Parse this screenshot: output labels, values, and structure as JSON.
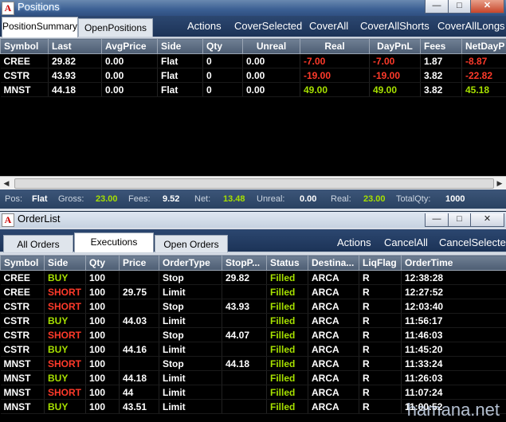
{
  "positions_window": {
    "title": "Positions",
    "app_icon": "A",
    "controls": [
      "minimize-icon",
      "maximize-icon",
      "close-icon"
    ],
    "tabs": [
      {
        "label": "PositionSummary",
        "active": true
      },
      {
        "label": "OpenPositions",
        "active": false
      }
    ],
    "toolbar": [
      "Actions",
      "CoverSelected",
      "CoverAll",
      "CoverAllShorts",
      "CoverAllLongs"
    ],
    "columns": [
      "Symbol",
      "Last",
      "AvgPrice",
      "Side",
      "Qty",
      "Unreal",
      "Real",
      "DayPnL",
      "Fees",
      "NetDayP"
    ],
    "rows": [
      [
        "CREE",
        "29.82",
        "0.00",
        "Flat",
        "0",
        "0.00",
        "-7.00",
        "-7.00",
        "1.87",
        "-8.87"
      ],
      [
        "CSTR",
        "43.93",
        "0.00",
        "Flat",
        "0",
        "0.00",
        "-19.00",
        "-19.00",
        "3.82",
        "-22.82"
      ],
      [
        "MNST",
        "44.18",
        "0.00",
        "Flat",
        "0",
        "0.00",
        "49.00",
        "49.00",
        "3.82",
        "45.18"
      ]
    ],
    "status": {
      "pos_label": "Pos:",
      "pos_value": "Flat",
      "gross_label": "Gross:",
      "gross_value": "23.00",
      "fees_label": "Fees:",
      "fees_value": "9.52",
      "net_label": "Net:",
      "net_value": "13.48",
      "unreal_label": "Unreal:",
      "unreal_value": "0.00",
      "real_label": "Real:",
      "real_value": "23.00",
      "totalqty_label": "TotalQty:",
      "totalqty_value": "1000"
    }
  },
  "orderlist_window": {
    "title": "OrderList",
    "app_icon": "A",
    "tabs": [
      {
        "label": "All Orders",
        "active": false
      },
      {
        "label": "Executions",
        "active": true
      },
      {
        "label": "Open Orders",
        "active": false
      }
    ],
    "toolbar": [
      "Actions",
      "CancelAll",
      "CancelSelected"
    ],
    "columns": [
      "Symbol",
      "Side",
      "Qty",
      "Price",
      "OrderType",
      "StopP...",
      "Status",
      "Destina...",
      "LiqFlag",
      "OrderTime"
    ],
    "rows": [
      [
        "CREE",
        "BUY",
        "100",
        "",
        "Stop",
        "29.82",
        "Filled",
        "ARCA",
        "R",
        "12:38:28"
      ],
      [
        "CREE",
        "SHORT",
        "100",
        "29.75",
        "Limit",
        "",
        "Filled",
        "ARCA",
        "R",
        "12:27:52"
      ],
      [
        "CSTR",
        "SHORT",
        "100",
        "",
        "Stop",
        "43.93",
        "Filled",
        "ARCA",
        "R",
        "12:03:40"
      ],
      [
        "CSTR",
        "BUY",
        "100",
        "44.03",
        "Limit",
        "",
        "Filled",
        "ARCA",
        "R",
        "11:56:17"
      ],
      [
        "CSTR",
        "SHORT",
        "100",
        "",
        "Stop",
        "44.07",
        "Filled",
        "ARCA",
        "R",
        "11:46:03"
      ],
      [
        "CSTR",
        "BUY",
        "100",
        "44.16",
        "Limit",
        "",
        "Filled",
        "ARCA",
        "R",
        "11:45:20"
      ],
      [
        "MNST",
        "SHORT",
        "100",
        "",
        "Stop",
        "44.18",
        "Filled",
        "ARCA",
        "R",
        "11:33:24"
      ],
      [
        "MNST",
        "BUY",
        "100",
        "44.18",
        "Limit",
        "",
        "Filled",
        "ARCA",
        "R",
        "11:26:03"
      ],
      [
        "MNST",
        "SHORT",
        "100",
        "44",
        "Limit",
        "",
        "Filled",
        "ARCA",
        "R",
        "11:07:24"
      ],
      [
        "MNST",
        "BUY",
        "100",
        "43.51",
        "Limit",
        "",
        "Filled",
        "ARCA",
        "R",
        "11:00:52"
      ]
    ]
  },
  "watermark": "hamana.net",
  "colors": {
    "positive": "#a6e000",
    "negative": "#ff3a2a",
    "grid_bg": "#000000",
    "header_bg": "#5d6d82"
  }
}
